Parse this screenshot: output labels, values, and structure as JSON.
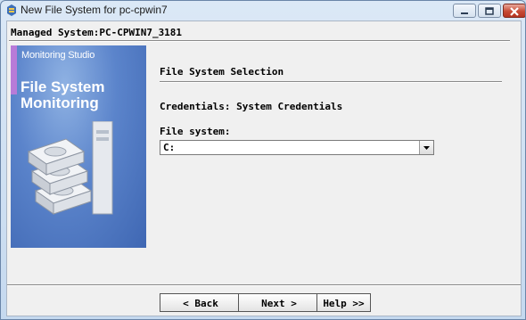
{
  "window": {
    "title": "New File System for pc-cpwin7"
  },
  "header": {
    "managed_system": "Managed System:PC-CPWIN7_3181"
  },
  "banner": {
    "subtitle": "Monitoring Studio",
    "title": "File System Monitoring"
  },
  "form": {
    "section_title": "File System Selection",
    "credentials": "Credentials: System Credentials",
    "file_system_label": "File system:",
    "file_system_value": "C:"
  },
  "buttons": {
    "back": "< Back",
    "next": "Next >",
    "help": "Help >>"
  },
  "colors": {
    "accent_stripe": "#b87bd8",
    "banner_bg": "#5b84cb",
    "close_button": "#c74a35"
  }
}
